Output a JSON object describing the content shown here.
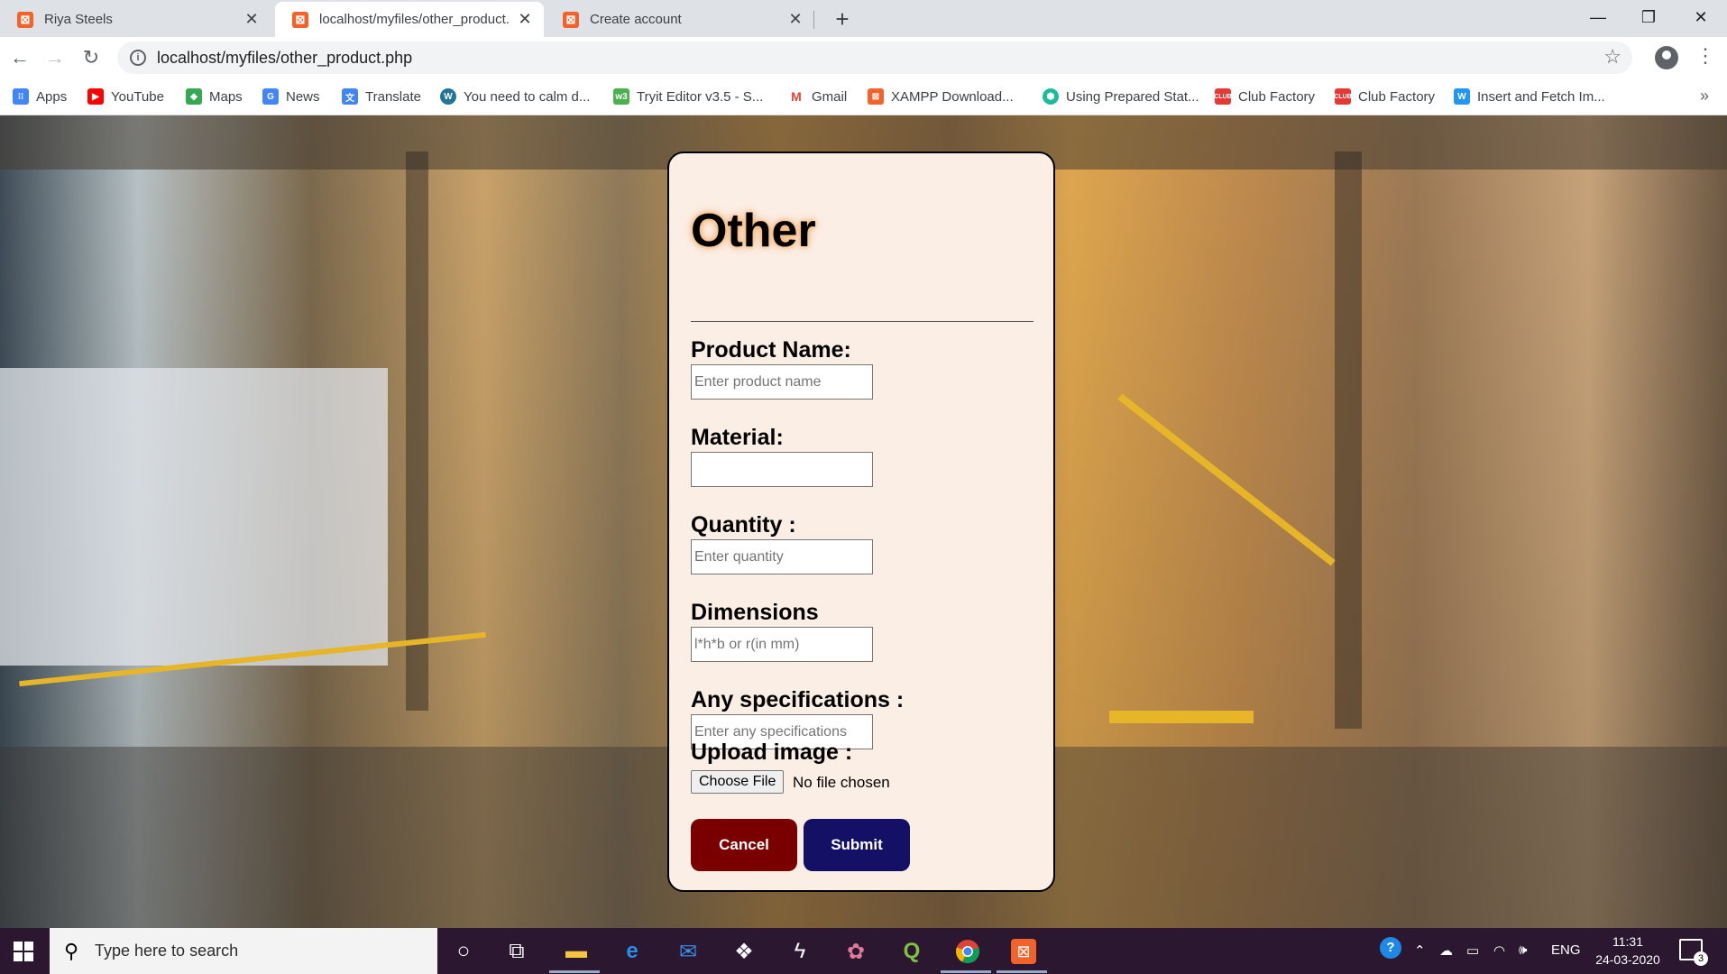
{
  "browser": {
    "tabs": [
      {
        "title": "Riya Steels",
        "favicon": "xampp-icon"
      },
      {
        "title": "localhost/myfiles/other_product.",
        "favicon": "xampp-icon"
      },
      {
        "title": "Create account",
        "favicon": "xampp-icon"
      }
    ],
    "url": "localhost/myfiles/other_product.php",
    "bookmarks": [
      {
        "label": "Apps",
        "icon": "apps-grid-icon",
        "color": "#4285f4"
      },
      {
        "label": "YouTube",
        "icon": "youtube-icon",
        "color": "#ff0000"
      },
      {
        "label": "Maps",
        "icon": "maps-icon",
        "color": "#34a853"
      },
      {
        "label": "News",
        "icon": "news-icon",
        "color": "#4285f4"
      },
      {
        "label": "Translate",
        "icon": "translate-icon",
        "color": "#4285f4"
      },
      {
        "label": "You need to calm d...",
        "icon": "wordpress-icon",
        "color": "#21759b"
      },
      {
        "label": "Tryit Editor v3.5 - S...",
        "icon": "w3schools-icon",
        "color": "#4caf50"
      },
      {
        "label": "Gmail",
        "icon": "gmail-icon",
        "color": "#ea4335"
      },
      {
        "label": "XAMPP Download...",
        "icon": "xampp-icon",
        "color": "#f2632b"
      },
      {
        "label": "Using Prepared Stat...",
        "icon": "hexagon-icon",
        "color": "#1abc9c"
      },
      {
        "label": "Club Factory",
        "icon": "club-factory-icon",
        "color": "#e53935"
      },
      {
        "label": "Club Factory",
        "icon": "club-factory-icon",
        "color": "#e53935"
      },
      {
        "label": "Insert and Fetch Im...",
        "icon": "w-icon",
        "color": "#2196f3"
      }
    ]
  },
  "form": {
    "title": "Other",
    "product_name": {
      "label": "Product Name:",
      "placeholder": "Enter product name"
    },
    "material": {
      "label": "Material:",
      "placeholder": ""
    },
    "quantity": {
      "label": "Quantity :",
      "placeholder": "Enter quantity"
    },
    "dimensions": {
      "label": "Dimensions",
      "placeholder": "l*h*b or r(in mm)"
    },
    "specifications": {
      "label": "Any specifications :",
      "placeholder": "Enter any specifications"
    },
    "upload": {
      "label": "Upload image :",
      "button": "Choose File",
      "status": "No file chosen"
    },
    "cancel_label": "Cancel",
    "submit_label": "Submit",
    "colors": {
      "card": "#fbeee5",
      "cancel": "#7a0000",
      "submit": "#141066"
    }
  },
  "taskbar": {
    "search_placeholder": "Type here to search",
    "language": "ENG",
    "time": "11:31",
    "date": "24-03-2020",
    "notification_count": "3"
  }
}
